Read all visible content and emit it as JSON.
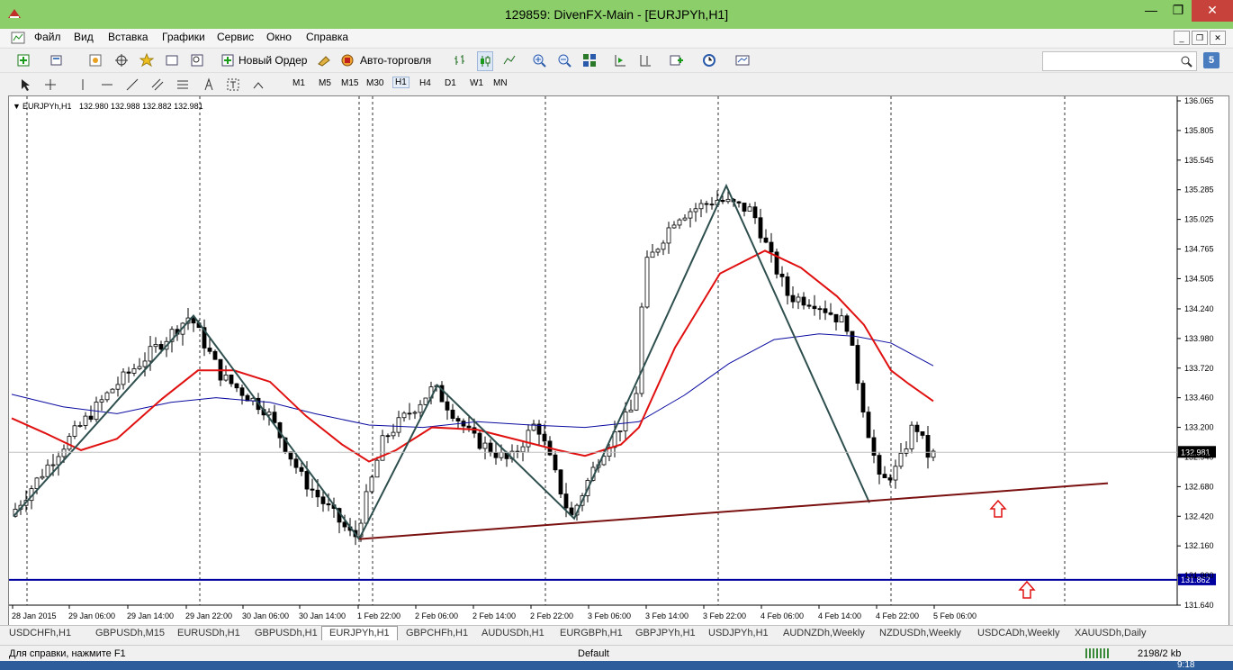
{
  "window": {
    "title": "129859: DivenFX-Main - [EURJPYh,H1]"
  },
  "menu": [
    "Файл",
    "Вид",
    "Вставка",
    "Графики",
    "Сервис",
    "Окно",
    "Справка"
  ],
  "toolbar": {
    "new_order": "Новый Ордер",
    "autotrading": "Авто-торговля",
    "notify_count": "5"
  },
  "timeframes": [
    "M1",
    "M5",
    "M15",
    "M30",
    "H1",
    "H4",
    "D1",
    "W1",
    "MN"
  ],
  "active_timeframe": "H1",
  "chart_header": {
    "symbol": "EURJPYh,H1",
    "ohlc": "132.980 132.988 132.882 132.981"
  },
  "price_labels": [
    "136.065",
    "135.805",
    "135.545",
    "135.285",
    "135.025",
    "134.765",
    "134.505",
    "134.240",
    "133.980",
    "133.720",
    "133.460",
    "133.200",
    "132.940",
    "132.680",
    "132.420",
    "132.160",
    "131.900",
    "131.640"
  ],
  "current_price": "132.981",
  "hline_price": "131.862",
  "time_labels": [
    "28 Jan 2015",
    "29 Jan 06:00",
    "29 Jan 14:00",
    "29 Jan 22:00",
    "30 Jan 06:00",
    "30 Jan 14:00",
    "1 Feb 22:00",
    "2 Feb 06:00",
    "2 Feb 14:00",
    "2 Feb 22:00",
    "3 Feb 06:00",
    "3 Feb 14:00",
    "3 Feb 22:00",
    "4 Feb 06:00",
    "4 Feb 14:00",
    "4 Feb 22:00",
    "5 Feb 06:00"
  ],
  "tabs": [
    "USDCHFh,H1",
    "GBPUSDh,M15",
    "EURUSDh,H1",
    "GBPUSDh,H1",
    "EURJPYh,H1",
    "GBPCHFh,H1",
    "AUDUSDh,H1",
    "EURGBPh,H1",
    "GBPJPYh,H1",
    "USDJPYh,H1",
    "AUDNZDh,Weekly",
    "NZDUSDh,Weekly",
    "USDCADh,Weekly",
    "XAUUSDh,Daily"
  ],
  "active_tab": "EURJPYh,H1",
  "status": {
    "help": "Для справки, нажмите F1",
    "profile": "Default",
    "traffic": "2198/2 kb",
    "clock": "9:18"
  },
  "colors": {
    "titlebar": "#8ccf6a",
    "ma_fast": "#e01010",
    "ma_slow": "#0a0aa0",
    "zigzag": "#2f4f4f",
    "trendline": "#7a1010",
    "hline": "#0000a0",
    "arrows": "#e01010"
  }
}
